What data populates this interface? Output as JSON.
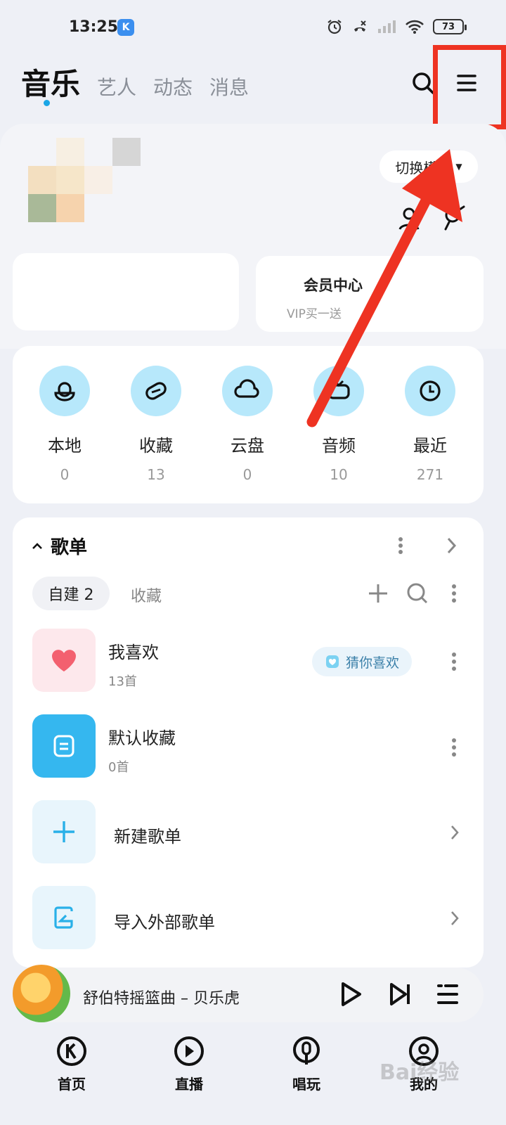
{
  "status_bar": {
    "time": "13:25",
    "app_badge": "K",
    "battery": "73"
  },
  "top_tabs": {
    "active": "音乐",
    "others": [
      "艺人",
      "动态",
      "消息"
    ]
  },
  "profile": {
    "switch_mode_label": "切换模式",
    "vip_title": "会员中心",
    "vip_subtitle": "VIP买一送"
  },
  "shortcuts": [
    {
      "label": "本地",
      "count": "0",
      "icon": "local-music-icon"
    },
    {
      "label": "收藏",
      "count": "13",
      "icon": "favorites-icon"
    },
    {
      "label": "云盘",
      "count": "0",
      "icon": "cloud-icon"
    },
    {
      "label": "音频",
      "count": "10",
      "icon": "radio-icon"
    },
    {
      "label": "最近",
      "count": "271",
      "icon": "clock-icon"
    }
  ],
  "playlists": {
    "section_title": "歌单",
    "chip_self": "自建 2",
    "chip_fav": "收藏",
    "items": [
      {
        "title": "我喜欢",
        "sub": "13首",
        "badge": "猜你喜欢"
      },
      {
        "title": "默认收藏",
        "sub": "0首"
      }
    ],
    "actions": [
      "新建歌单",
      "导入外部歌单"
    ]
  },
  "player": {
    "song": "舒伯特摇篮曲  –  贝乐虎"
  },
  "bottom_nav": [
    {
      "label": "首页",
      "icon": "home-k-icon"
    },
    {
      "label": "直播",
      "icon": "live-icon"
    },
    {
      "label": "唱玩",
      "icon": "sing-icon"
    },
    {
      "label": "我的",
      "icon": "profile-icon"
    }
  ],
  "watermark": "Bai经验",
  "colors": {
    "accent": "#1aa6e6",
    "annotation_red": "#ee3322",
    "shortcut_bg": "#b7e8fb"
  }
}
